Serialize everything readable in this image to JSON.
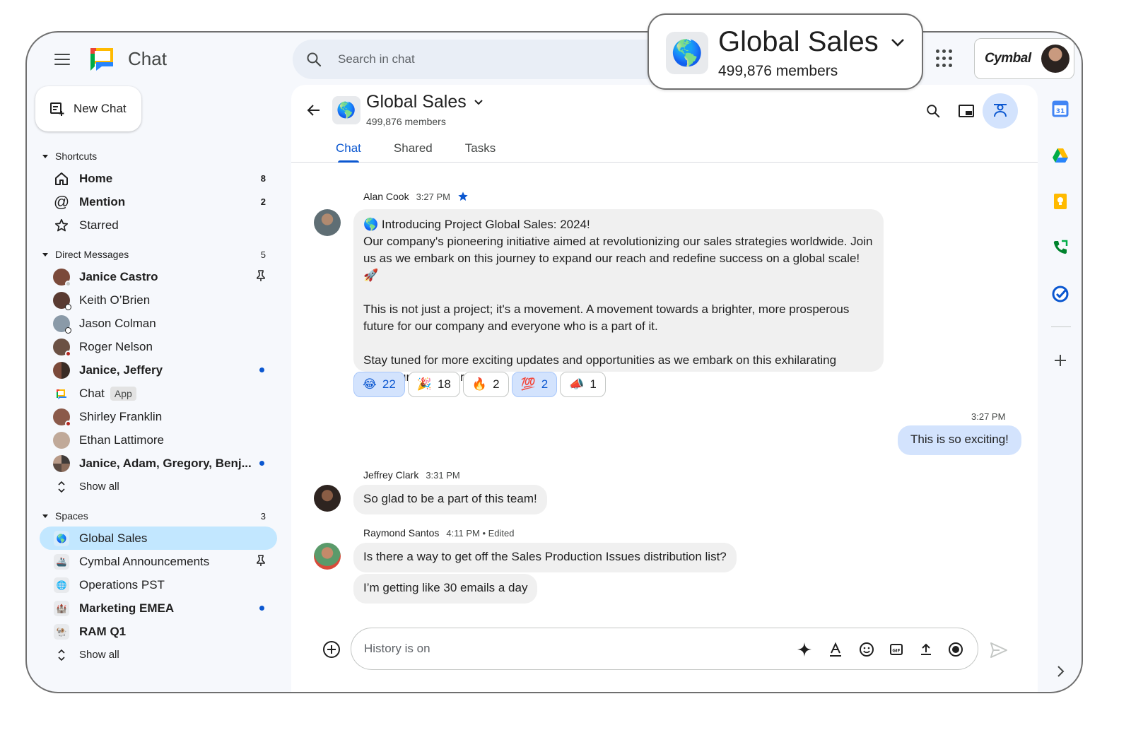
{
  "app": {
    "name": "Chat"
  },
  "search": {
    "placeholder": "Search in chat"
  },
  "account": {
    "brand": "Cymbal"
  },
  "new_chat": {
    "label": "New Chat"
  },
  "shortcuts": {
    "title": "Shortcuts",
    "items": [
      {
        "label": "Home",
        "count": "8",
        "icon": "home-icon"
      },
      {
        "label": "Mention",
        "count": "2",
        "icon": "at-icon"
      },
      {
        "label": "Starred",
        "count": "",
        "icon": "star-icon"
      }
    ]
  },
  "direct_messages": {
    "title": "Direct Messages",
    "count": "5",
    "items": [
      {
        "label": "Janice Castro",
        "bold": true,
        "pinned": true,
        "color": "#7b4a3a"
      },
      {
        "label": "Keith O’Brien",
        "bold": false,
        "color": "#5a3b32"
      },
      {
        "label": "Jason Colman",
        "bold": false,
        "color": "#8a9aa8"
      },
      {
        "label": "Roger Nelson",
        "bold": false,
        "color": "#6b5144"
      },
      {
        "label": "Janice, Jeffery",
        "bold": true,
        "unread": true,
        "color": "#4a3a33"
      },
      {
        "label": "Chat",
        "tag": "App",
        "bold": false
      },
      {
        "label": "Shirley Franklin",
        "bold": false,
        "color": "#8b5a4a"
      },
      {
        "label": "Ethan Lattimore",
        "bold": false,
        "color": "#c0a999"
      },
      {
        "label": "Janice, Adam, Gregory, Benj...",
        "bold": true,
        "unread": true,
        "color": "#3f3a38"
      }
    ],
    "show_all": "Show all"
  },
  "spaces": {
    "title": "Spaces",
    "count": "3",
    "items": [
      {
        "label": "Global Sales",
        "selected": true,
        "emoji": "🌎"
      },
      {
        "label": "Cymbal Announcements",
        "pinned": true,
        "emoji": "🚢"
      },
      {
        "label": "Operations PST",
        "emoji": "🌐"
      },
      {
        "label": "Marketing EMEA",
        "bold": true,
        "unread": true,
        "emoji": "🏰"
      },
      {
        "label": "RAM Q1",
        "bold": true,
        "emoji": "🐏"
      }
    ],
    "show_all": "Show all"
  },
  "space_header": {
    "emoji": "🌎",
    "title": "Global Sales",
    "members": "499,876 members",
    "tabs": [
      "Chat",
      "Shared",
      "Tasks"
    ],
    "active_tab": 0
  },
  "messages": {
    "alan": {
      "author": "Alan Cook",
      "time": "3:27 PM",
      "lines": [
        "🌎 Introducing Project Global Sales: 2024!",
        "Our company's pioneering initiative aimed at revolutionizing our sales strategies worldwide. Join",
        "us as we embark on this journey to expand our reach and redefine success on a global scale! 🚀",
        "",
        "This is not just a project; it's a movement. A movement towards a brighter, more prosperous",
        "future for our company and everyone who is a part of it.",
        "",
        "Stay tuned for more exciting updates and opportunities as we embark on this exhilarating",
        "adventure together."
      ],
      "reactions": [
        {
          "emoji": "😂",
          "count": "22",
          "active": true
        },
        {
          "emoji": "🎉",
          "count": "18",
          "active": false
        },
        {
          "emoji": "🔥",
          "count": "2",
          "active": false
        },
        {
          "emoji": "💯",
          "count": "2",
          "active": true
        },
        {
          "emoji": "📣",
          "count": "1",
          "active": false
        }
      ]
    },
    "mine": {
      "time": "3:27 PM",
      "text": "This is so exciting!"
    },
    "jeffrey": {
      "author": "Jeffrey Clark",
      "time": "3:31 PM",
      "text": "So glad to be a part of this team!"
    },
    "raymond": {
      "author": "Raymond Santos",
      "time": "4:11 PM • Edited",
      "texts": [
        "Is there a way to get off the Sales Production Issues distribution list?",
        "I’m getting like 30 emails a day"
      ]
    }
  },
  "composer": {
    "placeholder": "History is on"
  },
  "callout": {
    "emoji": "🌎",
    "title": "Global Sales",
    "members": "499,876 members"
  },
  "colors": {
    "accent": "#0b57d0",
    "selected_bg": "#c2e7ff",
    "mine_bubble": "#d3e3fd"
  }
}
